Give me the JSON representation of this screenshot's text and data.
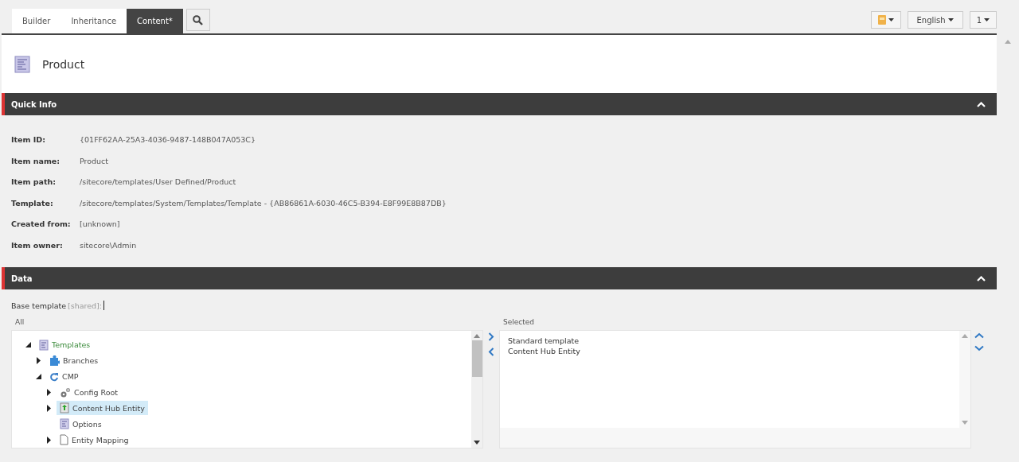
{
  "tabs": [
    {
      "label": "Builder",
      "selected": false
    },
    {
      "label": "Inheritance",
      "selected": false
    },
    {
      "label": "Content*",
      "selected": true
    }
  ],
  "toolbar": {
    "language": "English",
    "version": "1"
  },
  "header": {
    "title": "Product"
  },
  "quick_info": {
    "title": "Quick Info",
    "fields": [
      {
        "label": "Item ID:",
        "value": "{01FF62AA-25A3-4036-9487-148B047A053C}"
      },
      {
        "label": "Item name:",
        "value": "Product"
      },
      {
        "label": "Item path:",
        "value": "/sitecore/templates/User Defined/Product"
      },
      {
        "label": "Template:",
        "value": "/sitecore/templates/System/Templates/Template - {AB86861A-6030-46C5-B394-E8F99E8B87DB}"
      },
      {
        "label": "Created from:",
        "value": "[unknown]"
      },
      {
        "label": "Item owner:",
        "value": "sitecore\\Admin"
      }
    ]
  },
  "data": {
    "title": "Data",
    "field_label": "Base template",
    "field_note": "[shared]:",
    "all_label": "All",
    "selected_label": "Selected",
    "tree": [
      {
        "label": "Templates",
        "kind": "template",
        "expanded": true,
        "selected": false,
        "children": [
          {
            "label": "Branches",
            "kind": "branch",
            "expanded": false,
            "selected": false
          },
          {
            "label": "CMP",
            "kind": "sync",
            "expanded": true,
            "selected": false,
            "children": [
              {
                "label": "Config Root",
                "kind": "gears",
                "expanded": false,
                "selected": false
              },
              {
                "label": "Content Hub Entity",
                "kind": "entity",
                "expanded": false,
                "selected": true
              },
              {
                "label": "Options",
                "kind": "template",
                "selected": false
              },
              {
                "label": "Entity Mapping",
                "kind": "page",
                "expanded": false,
                "selected": false
              }
            ]
          }
        ]
      }
    ],
    "selected_items": [
      "Standard template",
      "Content Hub Entity"
    ]
  }
}
